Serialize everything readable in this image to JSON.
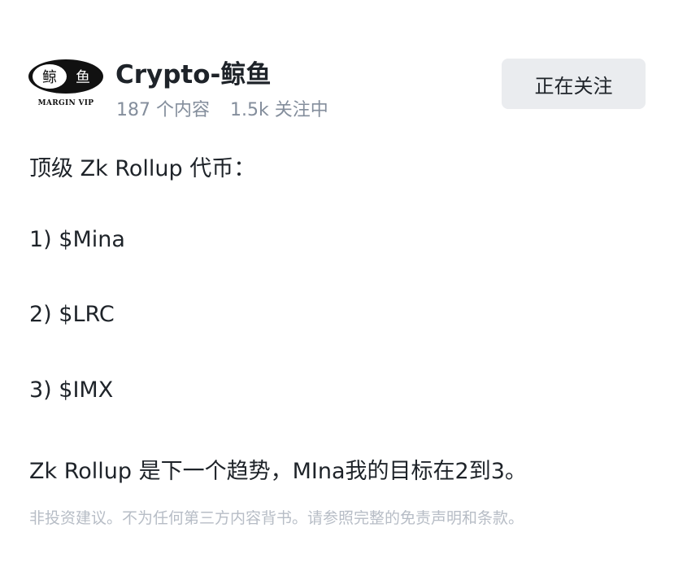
{
  "author": {
    "logo_chars": [
      "鲸",
      "鱼"
    ],
    "logo_caption": "MARGIN VIP",
    "name": "Crypto-鲸鱼",
    "posts_count": "187 个内容",
    "following_count": "1.5k 关注中",
    "follow_button_label": "正在关注"
  },
  "post": {
    "lines": [
      "顶级 Zk Rollup 代币：",
      "1) $Mina",
      "2) $LRC",
      "3) $IMX",
      "Zk Rollup 是下一个趋势，MIna我的目标在2到3。"
    ],
    "disclaimer": "非投资建议。不为任何第三方内容背书。请参照完整的免责声明和条款。"
  },
  "colors": {
    "text_primary": "#1e2329",
    "text_secondary": "#848e9c",
    "text_disclaimer": "#b7bdc6",
    "button_bg": "#eaecef"
  }
}
